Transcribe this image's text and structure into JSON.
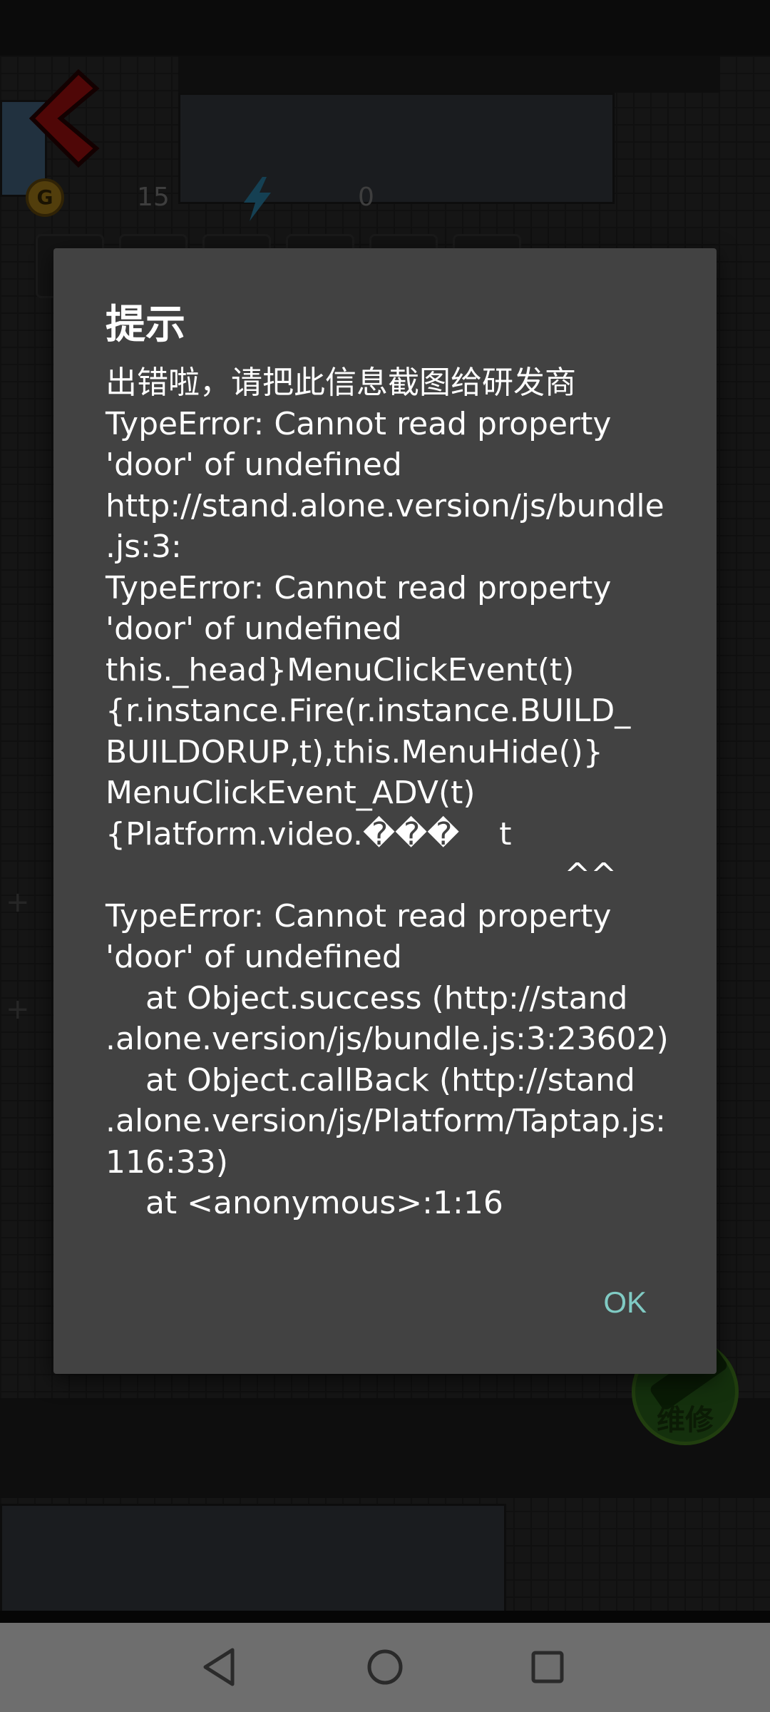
{
  "game": {
    "coins": "15",
    "energy": "0",
    "repair_label": "维修"
  },
  "dialog": {
    "title": "提示",
    "message": "出错啦，请把此信息截图给研发商\nTypeError: Cannot read property\n'door' of undefined\nhttp://stand.alone.version/js/bundle\n.js:3:\nTypeError: Cannot read property\n'door' of undefined\nthis._head}MenuClickEvent(t)\n{r.instance.Fire(r.instance.BUILD_\nBUILDORUP,t),this.MenuHide()}\nMenuClickEvent_ADV(t)\n{Platform.video.���    t\n                                              ^^\nTypeError: Cannot read property\n'door' of undefined\n    at Object.success (http://stand\n.alone.version/js/bundle.js:3:23602)\n    at Object.callBack (http://stand\n.alone.version/js/Platform/Taptap.js:\n116:33)\n    at <anonymous>:1:16",
    "ok_label": "OK"
  },
  "navbar": {
    "back_icon": "triangle-back-icon",
    "home_icon": "circle-home-icon",
    "recents_icon": "square-recents-icon"
  },
  "colors": {
    "dialog_bg": "#424242",
    "accent": "#80cbc4",
    "navbar_bg": "#6e6e6e"
  }
}
